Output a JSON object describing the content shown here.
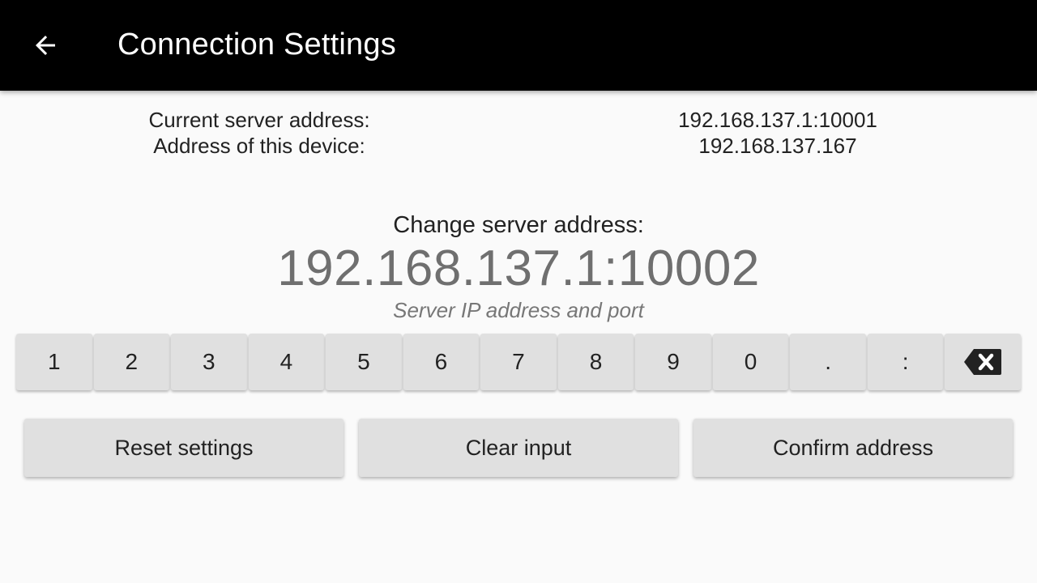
{
  "app_bar": {
    "title": "Connection Settings",
    "back_icon": "arrow-back-icon",
    "background": "#000000"
  },
  "info": {
    "current_server_label": "Current server address:",
    "current_server_value": "192.168.137.1:10001",
    "device_label": "Address of this device:",
    "device_value": "192.168.137.167"
  },
  "change": {
    "label": "Change server address:",
    "input_value": "192.168.137.1:10002",
    "hint": "Server IP address and port"
  },
  "keypad": {
    "keys": [
      "1",
      "2",
      "3",
      "4",
      "5",
      "6",
      "7",
      "8",
      "9",
      "0",
      ".",
      ":"
    ],
    "backspace_icon": "backspace-icon"
  },
  "actions": {
    "reset_label": "Reset settings",
    "clear_label": "Clear input",
    "confirm_label": "Confirm address"
  }
}
